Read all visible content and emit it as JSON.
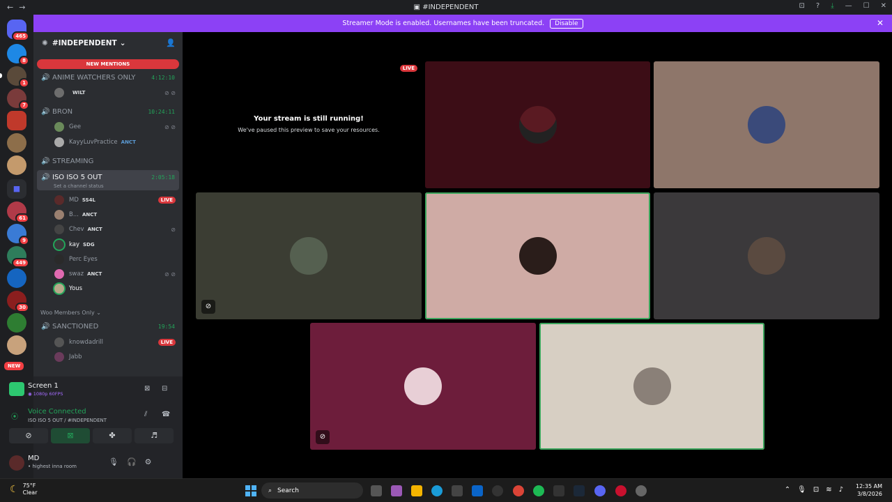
{
  "window": {
    "title": "#INDEPENDENT",
    "back": "←",
    "forward": "→"
  },
  "banner": {
    "text": "Streamer Mode is enabled. Usernames have been truncated.",
    "disable": "Disable",
    "close": "✕"
  },
  "guilds": {
    "badges": [
      "465",
      "8",
      "1",
      "7",
      "61",
      "9",
      "449",
      "30",
      "NEW"
    ]
  },
  "server": {
    "name": "#INDEPENDENT",
    "new_mentions": "NEW MENTIONS"
  },
  "channels": [
    {
      "name": "ANIME WATCHERS ONLY",
      "time": "4:12:10"
    },
    {
      "name": "BRON",
      "time": "10:24:11"
    },
    {
      "name": "STREAMING",
      "time": ""
    },
    {
      "name": "ISO ISO 5 OUT",
      "time": "2:05:18",
      "status": "Set a channel status"
    },
    {
      "name": "SANCTIONED",
      "time": "19:54"
    }
  ],
  "members": {
    "anime": [
      {
        "name": "",
        "tag": "WILT"
      }
    ],
    "bron": [
      {
        "name": "Gee",
        "tag": ""
      },
      {
        "name": "KayyLuvPractice",
        "tag": "ANCT"
      }
    ],
    "iso": [
      {
        "name": "MD",
        "tag": "SS4L",
        "live": "LIVE"
      },
      {
        "name": "B...",
        "tag": "ANCT"
      },
      {
        "name": "Chev",
        "tag": "ANCT"
      },
      {
        "name": "kay",
        "tag": "SDG"
      },
      {
        "name": "Perc Eyes",
        "tag": ""
      },
      {
        "name": "swaz",
        "tag": "ANCT"
      },
      {
        "name": "Yous",
        "tag": ""
      }
    ],
    "sanctioned": [
      {
        "name": "knowdadrill",
        "live": "LIVE"
      },
      {
        "name": "Jabb"
      }
    ]
  },
  "category": "Woo Members Only",
  "screen": {
    "title": "Screen 1",
    "quality": "1080p 60FPS"
  },
  "voice": {
    "status": "Voice Connected",
    "channel": "ISO ISO 5 OUT / #INDEPENDENT"
  },
  "user": {
    "name": "MD",
    "status": "• highest inna room"
  },
  "stream": {
    "live": "LIVE",
    "heading": "Your stream is still running!",
    "sub": "We've paused this preview to save your resources."
  },
  "taskbar": {
    "temp": "75°F",
    "weather": "Clear",
    "search": "Search",
    "time": "12:35 AM",
    "date": "3/8/2026"
  },
  "colors": {
    "accent": "#8c41f5",
    "green": "#23a55a",
    "red": "#da373c"
  }
}
